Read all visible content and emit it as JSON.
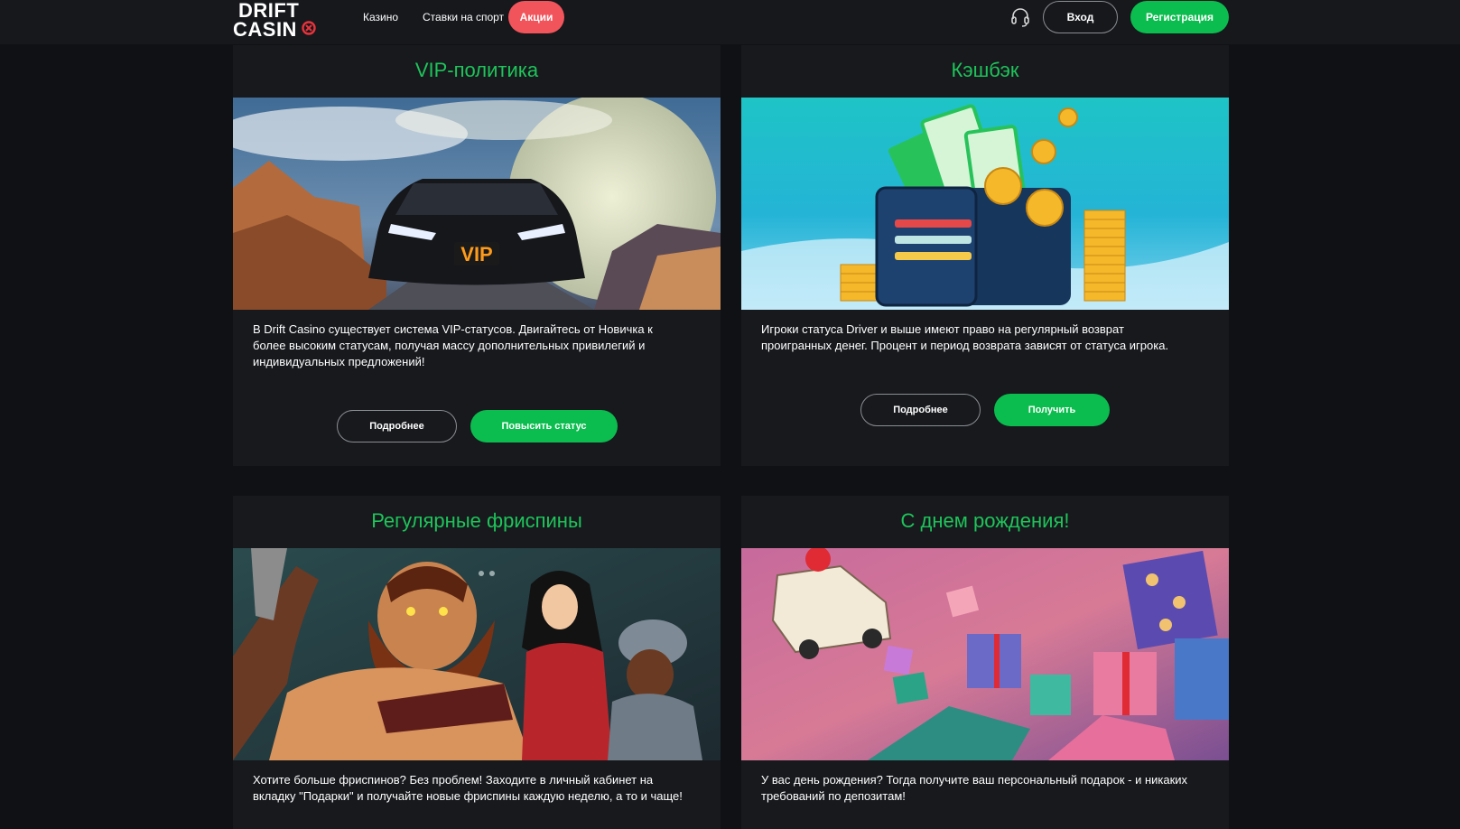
{
  "header": {
    "logo_line1": "DRIFT",
    "logo_line2": "CASIN",
    "nav": [
      "Казино",
      "Ставки на спорт",
      "Акции"
    ],
    "support_icon": "headset-icon",
    "login_label": "Вход",
    "register_label": "Регистрация"
  },
  "colors": {
    "accent_green": "#0bbd4e",
    "title_green": "#1ec45a",
    "promo_red": "#f2545b",
    "background": "#0f1114",
    "card": "#17191d"
  },
  "cards": [
    {
      "title": "VIP-политика",
      "image": "vip-car-image",
      "text": "В Drift Casino существует система VIP-статусов. Двигайтесь от Новичка к более высоким статусам, получая массу дополнительных привилегий и индивидуальных предложений!",
      "image_text": "VIP",
      "more_label": "Подробнее",
      "action_label": "Повысить статус"
    },
    {
      "title": "Кэшбэк",
      "image": "cashback-wallet-image",
      "text": "Игроки статуса Driver и выше имеют право на регулярный возврат проигранных денег. Процент и период возврата зависят от статуса игрока.",
      "more_label": "Подробнее",
      "action_label": "Получить"
    },
    {
      "title": "Регулярные фриспины",
      "image": "freespins-characters-image",
      "text": "Хотите больше фриспинов? Без проблем! Заходите в личный кабинет на вкладку \"Подарки\" и получайте новые фриспины каждую неделю, а то и чаще!"
    },
    {
      "title": "С днем рождения!",
      "image": "birthday-gifts-image",
      "text": "У вас день рождения? Тогда получите ваш персональный подарок - и никаких требований по депозитам!"
    }
  ]
}
